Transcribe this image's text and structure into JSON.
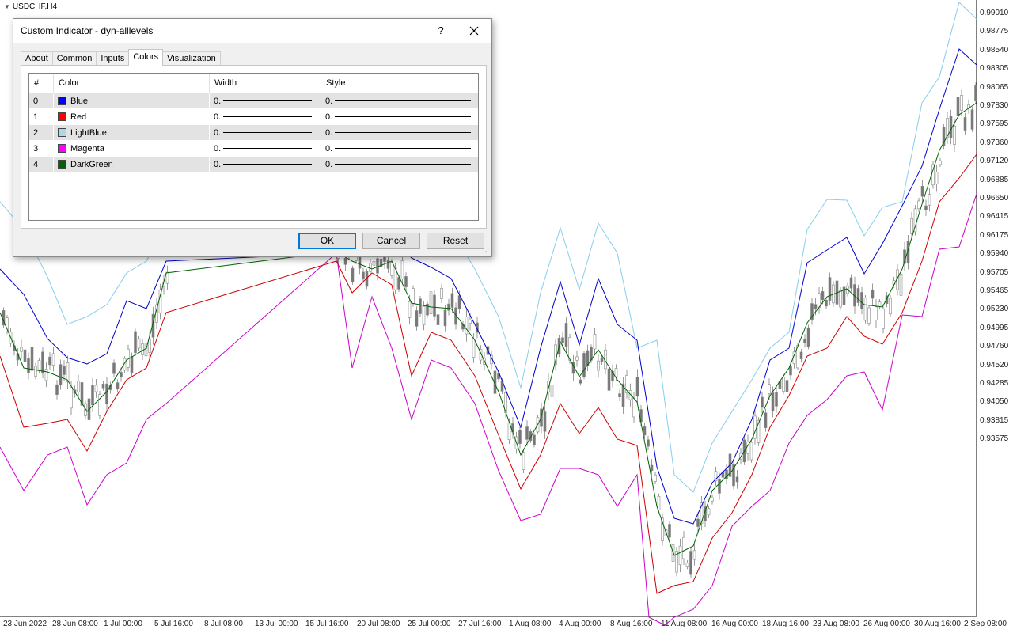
{
  "chart": {
    "symbol_label": "USDCHF,H4",
    "price_labels": [
      "0.99010",
      "0.98775",
      "0.98540",
      "0.98305",
      "0.98065",
      "0.97830",
      "0.97595",
      "0.97360",
      "0.97120",
      "0.96885",
      "0.96650",
      "0.96415",
      "0.96175",
      "0.95940",
      "0.95705",
      "0.95465",
      "0.95230",
      "0.94995",
      "0.94760",
      "0.94520",
      "0.94285",
      "0.94050",
      "0.93815",
      "0.93575"
    ],
    "date_labels": [
      "23 Jun 2022",
      "28 Jun 08:00",
      "1 Jul 00:00",
      "5 Jul 16:00",
      "8 Jul 08:00",
      "13 Jul 00:00",
      "15 Jul 16:00",
      "20 Jul 08:00",
      "25 Jul 00:00",
      "27 Jul 16:00",
      "1 Aug 08:00",
      "4 Aug 00:00",
      "8 Aug 16:00",
      "11 Aug 08:00",
      "16 Aug 00:00",
      "18 Aug 16:00",
      "23 Aug 08:00",
      "26 Aug 00:00",
      "30 Aug 16:00",
      "2 Sep 08:00"
    ],
    "colors": {
      "blue": "#0000cc",
      "red": "#cc0000",
      "lightblue": "#87ceeb",
      "magenta": "#cc00cc",
      "darkgreen": "#006400",
      "candle": "#8a8a8a"
    }
  },
  "dialog": {
    "title": "Custom Indicator - dyn-alllevels",
    "help": "?",
    "tabs": [
      {
        "label": "About"
      },
      {
        "label": "Common"
      },
      {
        "label": "Inputs"
      },
      {
        "label": "Colors"
      },
      {
        "label": "Visualization"
      }
    ],
    "active_tab": "Colors",
    "grid": {
      "headers": [
        "#",
        "Color",
        "Width",
        "Style"
      ],
      "rows": [
        {
          "num": "0",
          "color_name": "Blue",
          "color_hex": "#0000ff",
          "width": "0.",
          "style": "0."
        },
        {
          "num": "1",
          "color_name": "Red",
          "color_hex": "#ff0000",
          "width": "0.",
          "style": "0."
        },
        {
          "num": "2",
          "color_name": "LightBlue",
          "color_hex": "#add8e6",
          "width": "0.",
          "style": "0."
        },
        {
          "num": "3",
          "color_name": "Magenta",
          "color_hex": "#ff00ff",
          "width": "0.",
          "style": "0."
        },
        {
          "num": "4",
          "color_name": "DarkGreen",
          "color_hex": "#006400",
          "width": "0.",
          "style": "0."
        }
      ]
    },
    "buttons": {
      "ok": "OK",
      "cancel": "Cancel",
      "reset": "Reset"
    }
  }
}
